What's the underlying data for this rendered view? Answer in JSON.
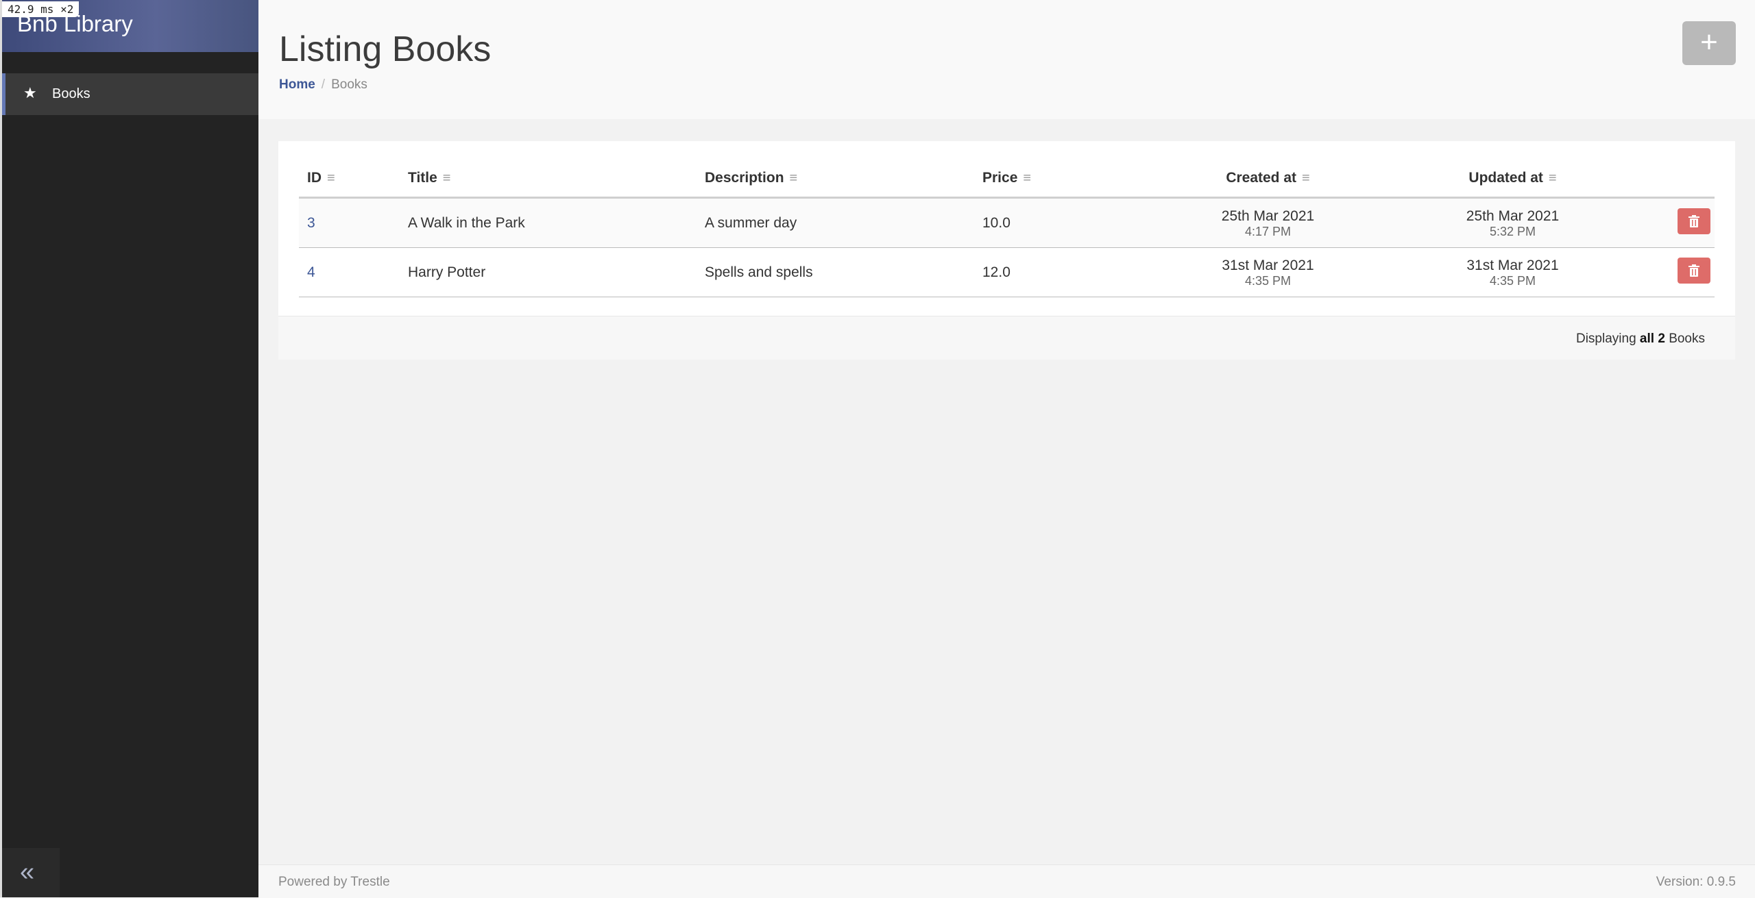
{
  "perf_badge": "42.9 ms ×2",
  "sidebar": {
    "brand": "Bnb Library",
    "items": [
      {
        "label": "Books",
        "icon": "star-icon"
      }
    ],
    "collapse_icon": "double-chevron-left-icon"
  },
  "header": {
    "title": "Listing Books",
    "breadcrumb": {
      "home": "Home",
      "separator": "/",
      "current": "Books"
    },
    "add_button": "+"
  },
  "table": {
    "columns": [
      "ID",
      "Title",
      "Description",
      "Price",
      "Created at",
      "Updated at"
    ],
    "rows": [
      {
        "id": "3",
        "title": "A Walk in the Park",
        "description": "A summer day",
        "price": "10.0",
        "created_date": "25th Mar 2021",
        "created_time": "4:17 PM",
        "updated_date": "25th Mar 2021",
        "updated_time": "5:32 PM"
      },
      {
        "id": "4",
        "title": "Harry Potter",
        "description": "Spells and spells",
        "price": "12.0",
        "created_date": "31st Mar 2021",
        "created_time": "4:35 PM",
        "updated_date": "31st Mar 2021",
        "updated_time": "4:35 PM"
      }
    ],
    "footer": {
      "prefix": "Displaying",
      "bold": "all 2",
      "suffix": "Books"
    }
  },
  "footer": {
    "powered": "Powered by Trestle",
    "version": "Version: 0.9.5"
  },
  "colors": {
    "accent": "#3d5796",
    "danger": "#d9534f",
    "sidebar_bg": "#232323"
  }
}
